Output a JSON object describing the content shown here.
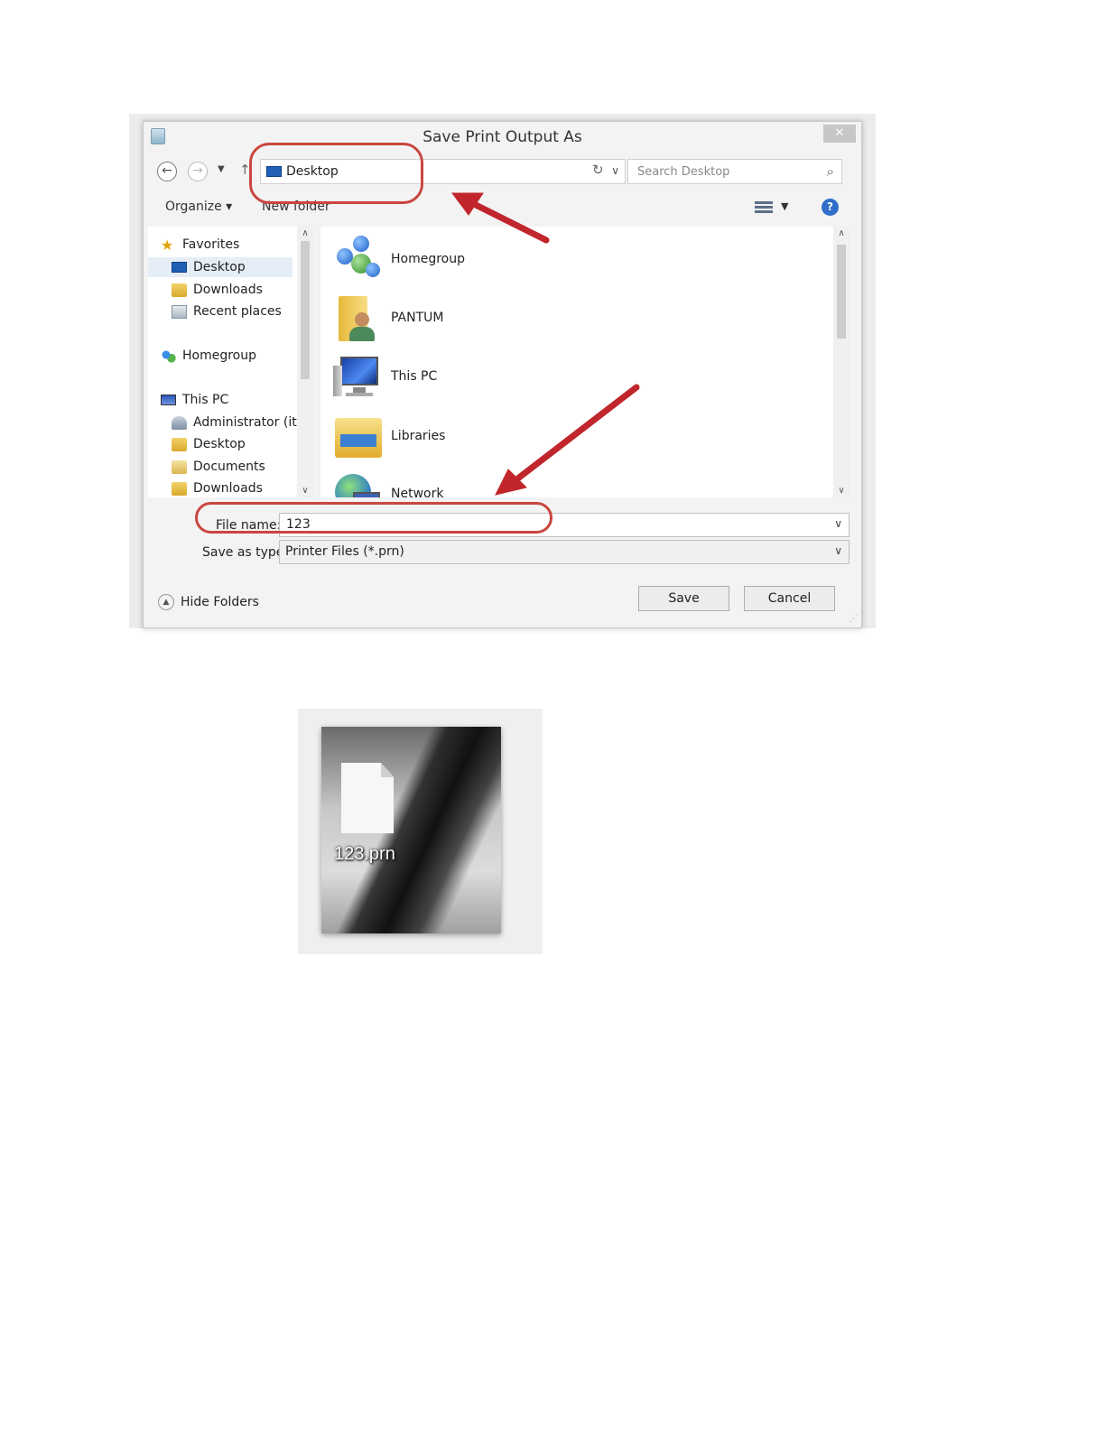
{
  "dialog": {
    "title": "Save Print Output As",
    "close_glyph": "✕",
    "address": "Desktop",
    "search_placeholder": "Search Desktop",
    "organize_label": "Organize ▾",
    "new_folder_label": "New folder",
    "help_glyph": "?"
  },
  "nav_pane": {
    "items": [
      {
        "label": "Favorites",
        "icon": "star-icon"
      },
      {
        "label": "Desktop",
        "icon": "desktop-icon",
        "selected": true
      },
      {
        "label": "Downloads",
        "icon": "downloads-icon"
      },
      {
        "label": "Recent places",
        "icon": "recent-places-icon"
      },
      {
        "label": "Homegroup",
        "icon": "homegroup-icon"
      },
      {
        "label": "This PC",
        "icon": "this-pc-icon"
      },
      {
        "label": "Administrator (it-",
        "icon": "user-folder-icon"
      },
      {
        "label": "Desktop",
        "icon": "folder-icon"
      },
      {
        "label": "Documents",
        "icon": "documents-icon"
      },
      {
        "label": "Downloads",
        "icon": "downloads-icon"
      }
    ]
  },
  "content": {
    "items": [
      {
        "label": "Homegroup",
        "icon": "homegroup-icon"
      },
      {
        "label": "PANTUM",
        "icon": "user-folder-icon"
      },
      {
        "label": "This PC",
        "icon": "this-pc-icon"
      },
      {
        "label": "Libraries",
        "icon": "libraries-icon"
      },
      {
        "label": "Network",
        "icon": "network-icon"
      }
    ]
  },
  "file_name": {
    "label": "File name:",
    "value": "123"
  },
  "save_as_type": {
    "label": "Save as type:",
    "value": "Printer Files (*.prn)"
  },
  "buttons": {
    "hide_folders": "Hide Folders",
    "save": "Save",
    "cancel": "Cancel"
  },
  "colors": {
    "annotation": "#c9463f",
    "arrow": "#c0262b",
    "accent": "#1f5fb5"
  },
  "desktop_icon": {
    "label": "123.prn",
    "icon": "file-icon"
  }
}
